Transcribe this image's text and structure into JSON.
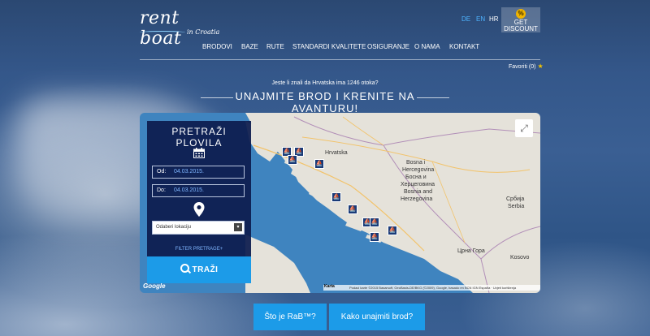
{
  "header": {
    "logo_text": "rent boat",
    "logo_sub": "in Croatia",
    "languages": [
      "DE",
      "EN",
      "HR"
    ],
    "discount_label_1": "GET",
    "discount_label_2": "DISCOUNT",
    "discount_icon": "percent-coin-icon"
  },
  "nav": {
    "items": [
      "BRODOVI",
      "BAZE",
      "RUTE",
      "STANDARDI KVALITETE",
      "OSIGURANJE",
      "O NAMA",
      "KONTAKT"
    ]
  },
  "favorites": {
    "label": "Favoriti (0)",
    "icon": "star-icon"
  },
  "hero": {
    "fact": "Jeste li znali da Hrvatska ima 1246 otoka?",
    "headline": "UNAJMITE BROD I KRENITE NA AVANTURU!"
  },
  "search": {
    "title": "PRETRAŽI PLOVILA",
    "from_label": "Od:",
    "from_value": "04.03.2015.",
    "to_label": "Do:",
    "to_value": "04.03.2015.",
    "location_placeholder": "Odaberi lokaciju",
    "filter_label": "FILTER PRETRAGE+",
    "search_button": "TRAŽI"
  },
  "map": {
    "labels": {
      "hrvatska": "Hrvatska",
      "bosna1": "Bosna i",
      "bosna2": "Hercegovina",
      "bosna3": "Босна и",
      "bosna4": "Херцеговина",
      "bosna5": "Bosnia and",
      "bosna6": "Herzegovina",
      "srbija1": "Србија",
      "srbija2": "Serbia",
      "crnagora": "Црна Гора",
      "kosovo": "Kosovo",
      "google": "Google",
      "karta": "Karta",
      "attribution": "Podaci karte ©2015 Basarsoft, GeoBasis-DE/BKG (©2009), Google, basado en BCN IGN España · Uvjeti korištenja"
    },
    "marker_count": 10,
    "marker_icon": "boat-marker-icon"
  },
  "buttons": {
    "what_is": "Što je RaB™?",
    "how_to": "Kako unajmiti brod?"
  },
  "colors": {
    "accent": "#1c9be8",
    "panel": "#0d1c4e",
    "link": "#4db3ff",
    "star": "#f5c400"
  }
}
